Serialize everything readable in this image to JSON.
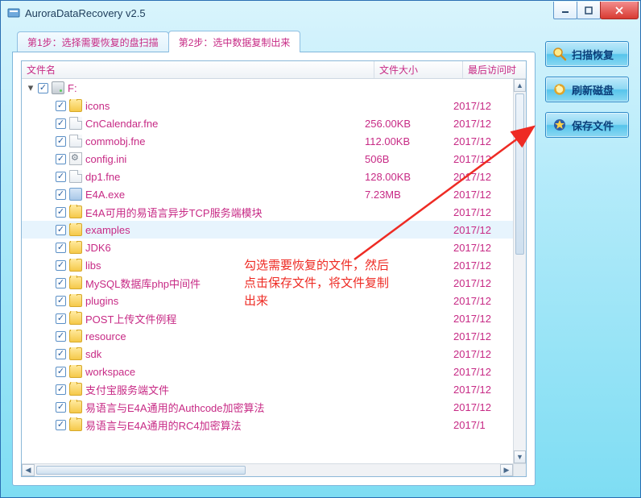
{
  "window": {
    "title": "AuroraDataRecovery v2.5"
  },
  "win_controls": {
    "min": "–",
    "max": "▢",
    "close": "✕"
  },
  "tabs": {
    "step1": "第1步：选择需要恢复的盘扫描",
    "step2": "第2步：选中数据复制出来"
  },
  "columns": {
    "name": "文件名",
    "size": "文件大小",
    "date": "最后访问时"
  },
  "actions": {
    "scan": "扫描恢复",
    "refresh": "刷新磁盘",
    "save": "保存文件"
  },
  "tree": {
    "root": {
      "name": "F:",
      "size": "",
      "date": "",
      "icon": "drive"
    },
    "children": [
      {
        "name": "icons",
        "size": "",
        "date": "2017/12",
        "icon": "folder"
      },
      {
        "name": "CnCalendar.fne",
        "size": "256.00KB",
        "date": "2017/12",
        "icon": "file"
      },
      {
        "name": "commobj.fne",
        "size": "112.00KB",
        "date": "2017/12",
        "icon": "file"
      },
      {
        "name": "config.ini",
        "size": "506B",
        "date": "2017/12",
        "icon": "ini"
      },
      {
        "name": "dp1.fne",
        "size": "128.00KB",
        "date": "2017/12",
        "icon": "file"
      },
      {
        "name": "E4A.exe",
        "size": "7.23MB",
        "date": "2017/12",
        "icon": "exe"
      },
      {
        "name": "E4A可用的易语言异步TCP服务端模块",
        "size": "",
        "date": "2017/12",
        "icon": "folder"
      },
      {
        "name": "examples",
        "size": "",
        "date": "2017/12",
        "icon": "folder",
        "selected": true
      },
      {
        "name": "JDK6",
        "size": "",
        "date": "2017/12",
        "icon": "folder"
      },
      {
        "name": "libs",
        "size": "",
        "date": "2017/12",
        "icon": "folder"
      },
      {
        "name": "MySQL数据库php中间件",
        "size": "",
        "date": "2017/12",
        "icon": "folder"
      },
      {
        "name": "plugins",
        "size": "",
        "date": "2017/12",
        "icon": "folder"
      },
      {
        "name": "POST上传文件例程",
        "size": "",
        "date": "2017/12",
        "icon": "folder"
      },
      {
        "name": "resource",
        "size": "",
        "date": "2017/12",
        "icon": "folder"
      },
      {
        "name": "sdk",
        "size": "",
        "date": "2017/12",
        "icon": "folder"
      },
      {
        "name": "workspace",
        "size": "",
        "date": "2017/12",
        "icon": "folder"
      },
      {
        "name": "支付宝服务端文件",
        "size": "",
        "date": "2017/12",
        "icon": "folder"
      },
      {
        "name": "易语言与E4A通用的Authcode加密算法",
        "size": "",
        "date": "2017/12",
        "icon": "folder"
      },
      {
        "name": "易语言与E4A通用的RC4加密算法",
        "size": "",
        "date": "2017/1",
        "icon": "folder"
      }
    ]
  },
  "annotation": {
    "line1": "勾选需要恢复的文件，然后",
    "line2": "点击保存文件，将文件复制",
    "line3": "出来"
  }
}
